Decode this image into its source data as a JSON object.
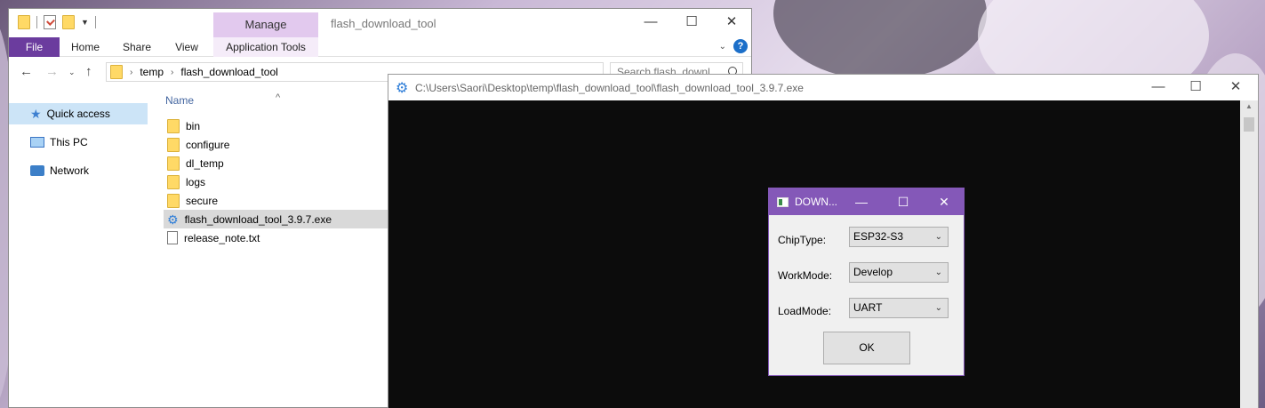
{
  "explorer": {
    "manage_tab": "Manage",
    "window_title": "flash_download_tool",
    "ribbon_tabs": {
      "file": "File",
      "home": "Home",
      "share": "Share",
      "view": "View",
      "app_tools": "Application Tools"
    },
    "address": {
      "crumbs": [
        "temp",
        "flash_download_tool"
      ]
    },
    "search_placeholder": "Search flash_downl...",
    "nav": {
      "quick_access": "Quick access",
      "this_pc": "This PC",
      "network": "Network"
    },
    "column_name": "Name",
    "files": [
      {
        "name": "bin",
        "type": "folder"
      },
      {
        "name": "configure",
        "type": "folder"
      },
      {
        "name": "dl_temp",
        "type": "folder"
      },
      {
        "name": "logs",
        "type": "folder"
      },
      {
        "name": "secure",
        "type": "folder"
      },
      {
        "name": "flash_download_tool_3.9.7.exe",
        "type": "exe"
      },
      {
        "name": "release_note.txt",
        "type": "txt"
      }
    ],
    "icons": {
      "close": "✕",
      "maximize": "☐",
      "minimize": "—"
    }
  },
  "console": {
    "title": "C:\\Users\\Saori\\Desktop\\temp\\flash_download_tool\\flash_download_tool_3.9.7.exe"
  },
  "dialog": {
    "title": "DOWN...",
    "chip_label": "ChipType:",
    "chip_value": "ESP32-S3",
    "work_label": "WorkMode:",
    "work_value": "Develop",
    "load_label": "LoadMode:",
    "load_value": "UART",
    "ok_label": "OK"
  },
  "colors": {
    "file_tab": "#6b3c9e",
    "manage_tab": "#e2c9ee",
    "dialog_title": "#8458b8",
    "console_bg": "#0c0c0c",
    "selection": "#cce4f7"
  }
}
